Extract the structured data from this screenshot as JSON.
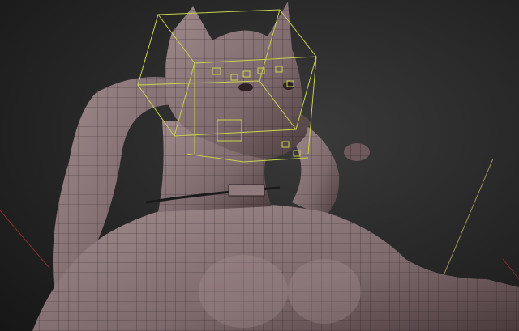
{
  "viewport": {
    "background_top": "#3a3a3a",
    "background_bottom": "#161616"
  },
  "model": {
    "skin_color": "#8f7a7c",
    "skin_shadow": "#4a3a3c",
    "wire_color": "#2a1f22",
    "cage_color": "#c8d24a",
    "nose_color": "#5a4a4c",
    "collar_color": "#1a1a1a"
  },
  "helpers": {
    "guide_line_color": "#9a8d5a",
    "axis_red": "#8a2c2c"
  }
}
